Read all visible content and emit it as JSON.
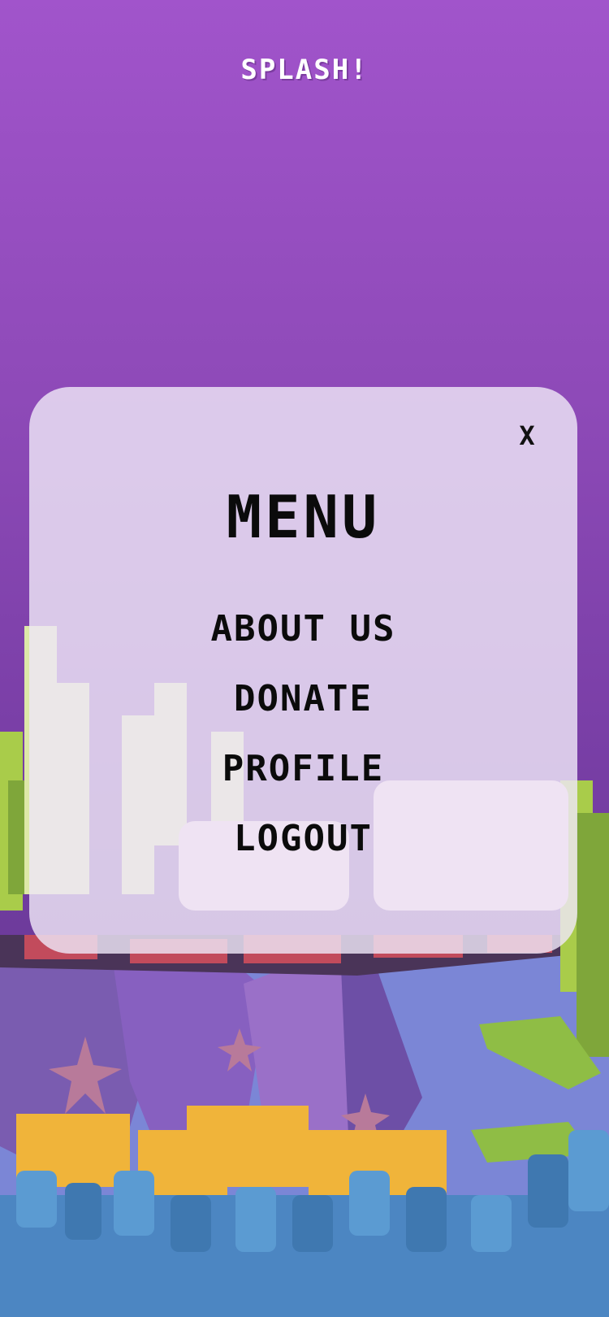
{
  "app": {
    "title": "SPLASH!"
  },
  "menu": {
    "title": "MENU",
    "close_label": "X",
    "items": [
      {
        "label": "ABOUT US"
      },
      {
        "label": "DONATE"
      },
      {
        "label": "PROFILE"
      },
      {
        "label": "LOGOUT"
      }
    ]
  },
  "colors": {
    "background_top": "#a154cb",
    "background_bottom": "#5b3790",
    "panel": "#ece4f5",
    "text": "#0b0b0b",
    "title_text": "#ffffff"
  }
}
